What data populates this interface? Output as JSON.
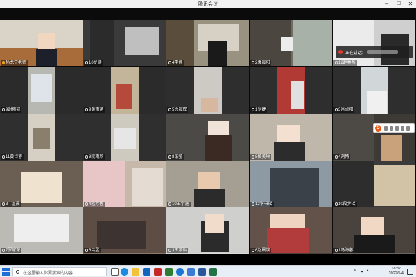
{
  "window": {
    "title": "腾讯会议"
  },
  "overlay": {
    "speaking_label": "正在讲话:"
  },
  "tiles": [
    {
      "label": "杨戈宁老师",
      "host": true
    },
    {
      "label": "10罗健"
    },
    {
      "label": "4李伟"
    },
    {
      "label": "2袁晨阳"
    },
    {
      "label": "12赵春燕"
    },
    {
      "label": "9谢俐宛"
    },
    {
      "label": "9黄雨菡"
    },
    {
      "label": "5徐晨辉"
    },
    {
      "label": "1罗婕"
    },
    {
      "label": "3肖卓阳"
    },
    {
      "label": "11黄诗睿"
    },
    {
      "label": "8阮雨欣"
    },
    {
      "label": "8张莹"
    },
    {
      "label": "8侯美琳"
    },
    {
      "label": "4刘畅"
    },
    {
      "label": "3 - 温晨"
    },
    {
      "label": "4欧芳佐"
    },
    {
      "label": "10王宇涵"
    },
    {
      "label": "12李书瑶"
    },
    {
      "label": "10段梦瑶"
    },
    {
      "label": "7罗家荣"
    },
    {
      "label": "6吕昱"
    },
    {
      "label": "3王紫怡"
    },
    {
      "label": "6赵晨滨"
    },
    {
      "label": "1马海蓉"
    }
  ],
  "taskbar": {
    "search_placeholder": "在这里输入你要搜索的内容",
    "time": "18:37",
    "date": "2022/5/4"
  },
  "colors": {
    "titlebar": "#f2f2f2",
    "taskbar": "#e8eef6",
    "host_badge": "#f0a020",
    "accent": "#1f6fd6"
  }
}
